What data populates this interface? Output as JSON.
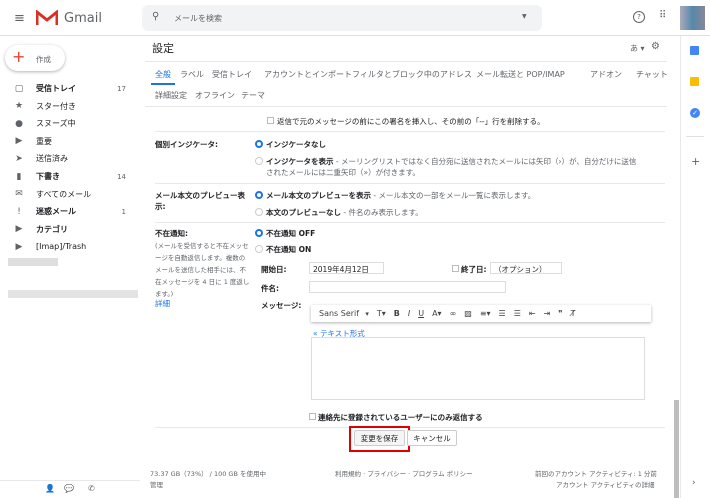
{
  "header": {
    "app_name": "Gmail",
    "search_placeholder": "メールを検索",
    "input_lang": "あ"
  },
  "compose_label": "作成",
  "sidebar": [
    {
      "icon": "inbox-icon",
      "glyph": "▢",
      "label": "受信トレイ",
      "count": "17",
      "bold": true
    },
    {
      "icon": "star-icon",
      "glyph": "★",
      "label": "スター付き",
      "count": "",
      "bold": false
    },
    {
      "icon": "clock-icon",
      "glyph": "●",
      "label": "スヌーズ中",
      "count": "",
      "bold": false
    },
    {
      "icon": "important-icon",
      "glyph": "▶",
      "label": "重要",
      "count": "",
      "bold": false
    },
    {
      "icon": "send-icon",
      "glyph": "➤",
      "label": "送信済み",
      "count": "",
      "bold": false
    },
    {
      "icon": "draft-icon",
      "glyph": "▮",
      "label": "下書き",
      "count": "14",
      "bold": true
    },
    {
      "icon": "mail-icon",
      "glyph": "✉",
      "label": "すべてのメール",
      "count": "",
      "bold": false
    },
    {
      "icon": "spam-icon",
      "glyph": "!",
      "label": "迷惑メール",
      "count": "1",
      "bold": true
    },
    {
      "icon": "label-icon",
      "glyph": "▶",
      "label": "カテゴリ",
      "count": "",
      "bold": true
    },
    {
      "icon": "label-icon",
      "glyph": "▶",
      "label": "[Imap]/Trash",
      "count": "",
      "bold": false
    }
  ],
  "settings": {
    "title": "設定",
    "tabs_row1": [
      "全般",
      "ラベル",
      "受信トレイ",
      "アカウントとインポート",
      "フィルタとブロック中のアドレス",
      "メール転送と POP/IMAP",
      "アドオン",
      "チャット"
    ],
    "tabs_row2": [
      "詳細設定",
      "オフライン",
      "テーマ"
    ],
    "active_tab": "全般",
    "signature_option": "返信で元のメッセージの前にこの署名を挿入し、その前の「--」行を削除する。",
    "indicator": {
      "label": "個別インジケータ:",
      "opt1": "インジケータなし",
      "opt2": "インジケータを表示",
      "opt2_desc1": " - メーリングリストではなく自分宛に送信されたメールには矢印（›）が、自分だけに送信",
      "opt2_desc2": "されたメールには二重矢印（»）が付きます。",
      "selected": "インジケータなし"
    },
    "preview": {
      "label1": "メール本文のプレビュー表",
      "label2": "示:",
      "opt1": "メール本文のプレビューを表示",
      "opt1_desc": " - メール本文の一部をメール一覧に表示します。",
      "opt2": "本文のプレビューなし",
      "opt2_desc": " - 件名のみ表示します。",
      "selected": "メール本文のプレビューを表示"
    },
    "vacation": {
      "label": "不在通知:",
      "desc": [
        "(メールを受信すると不在メッセ",
        "ージを自動返信します。複数の",
        "メールを送信した相手には、不",
        "在メッセージを 4 日に 1 度返し",
        "ます。)"
      ],
      "details_link": "詳細",
      "off": "不在通知 OFF",
      "on": "不在通知 ON",
      "selected": "不在通知 OFF",
      "start_label": "開始日:",
      "start_value": "2019年4月12日",
      "end_label": "終了日:",
      "end_placeholder": "（オプション）",
      "subject_label": "件名:",
      "subject_value": "",
      "message_label": "メッセージ:",
      "font": "Sans Serif",
      "plain_text_link": "« テキスト形式",
      "contacts_only": "連絡先に登録されているユーザーにのみ返信する"
    },
    "save_label": "変更を保存",
    "cancel_label": "キャンセル"
  },
  "footer": {
    "storage": "73.37 GB（73%） / 100 GB を使用中",
    "manage": "管理",
    "links": "利用規約 · プライバシー · プログラム ポリシー",
    "last_activity": "前回のアカウント アクティビティ: 1 分前",
    "activity_details": "アカウント アクティビティの詳細"
  },
  "colors": {
    "accent": "#1a73e8",
    "highlight_box": "#e00000"
  }
}
